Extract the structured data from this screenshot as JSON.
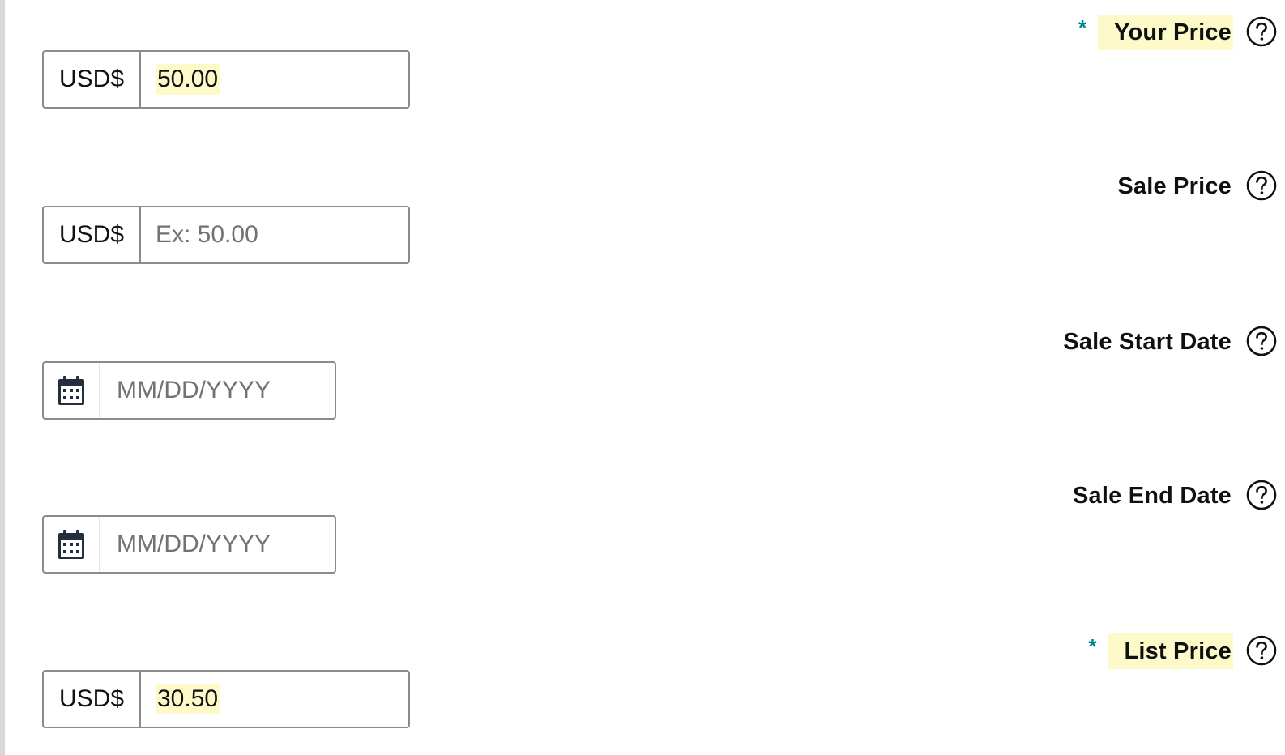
{
  "fields": [
    {
      "label": "Your Price",
      "required": true,
      "required_marker": "*",
      "highlight_label": true,
      "currency": "USD$",
      "value": "50.00",
      "placeholder": ""
    },
    {
      "label": "Sale Price",
      "required": false,
      "currency": "USD$",
      "value": "",
      "placeholder": "Ex: 50.00"
    },
    {
      "label": "Sale Start Date",
      "required": false,
      "placeholder": "MM/DD/YYYY"
    },
    {
      "label": "Sale End Date",
      "required": false,
      "placeholder": "MM/DD/YYYY"
    },
    {
      "label": "List Price",
      "required": true,
      "required_marker": "*",
      "highlight_label": true,
      "currency": "USD$",
      "value": "30.50",
      "placeholder": ""
    }
  ],
  "colors": {
    "required_star": "#008296",
    "highlight": "#fdf9c9",
    "border": "#888c8c",
    "placeholder": "#6f7373"
  },
  "icons": {
    "help": "help-circle-icon",
    "calendar": "calendar-icon"
  }
}
